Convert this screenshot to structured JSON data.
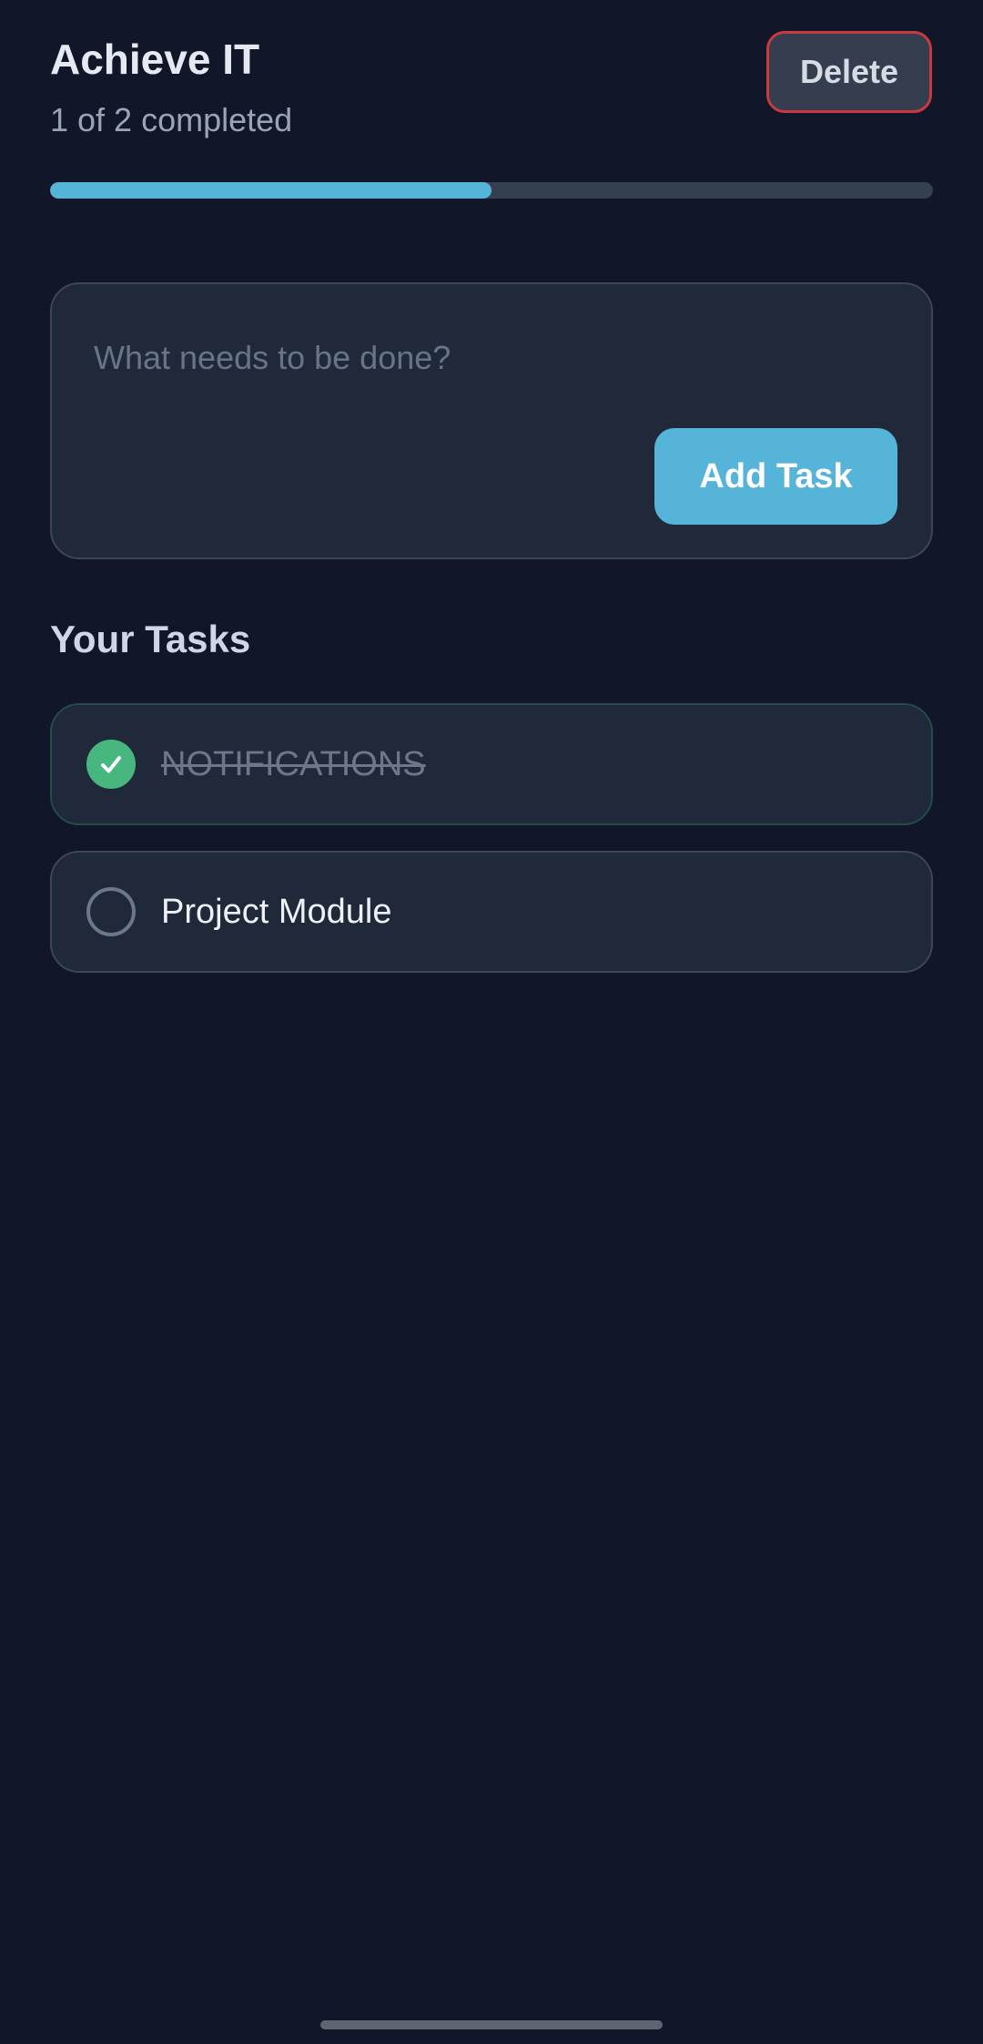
{
  "header": {
    "title": "Achieve IT",
    "subtitle": "1 of 2 completed",
    "delete_label": "Delete"
  },
  "progress": {
    "completed": 1,
    "total": 2,
    "fraction": 0.5
  },
  "new_task": {
    "placeholder": "What needs to be done?",
    "value": "",
    "add_label": "Add Task"
  },
  "tasks_section": {
    "title": "Your Tasks"
  },
  "tasks": [
    {
      "label": "NOTIFICATIONS",
      "completed": true
    },
    {
      "label": "Project Module",
      "completed": false
    }
  ],
  "colors": {
    "background": "#111628",
    "card": "#20293a",
    "accent": "#55b4d7",
    "success": "#47b67f",
    "danger": "#c9393f"
  },
  "icons": {
    "completed": "checkmark-circle-icon",
    "pending": "empty-circle-icon"
  }
}
